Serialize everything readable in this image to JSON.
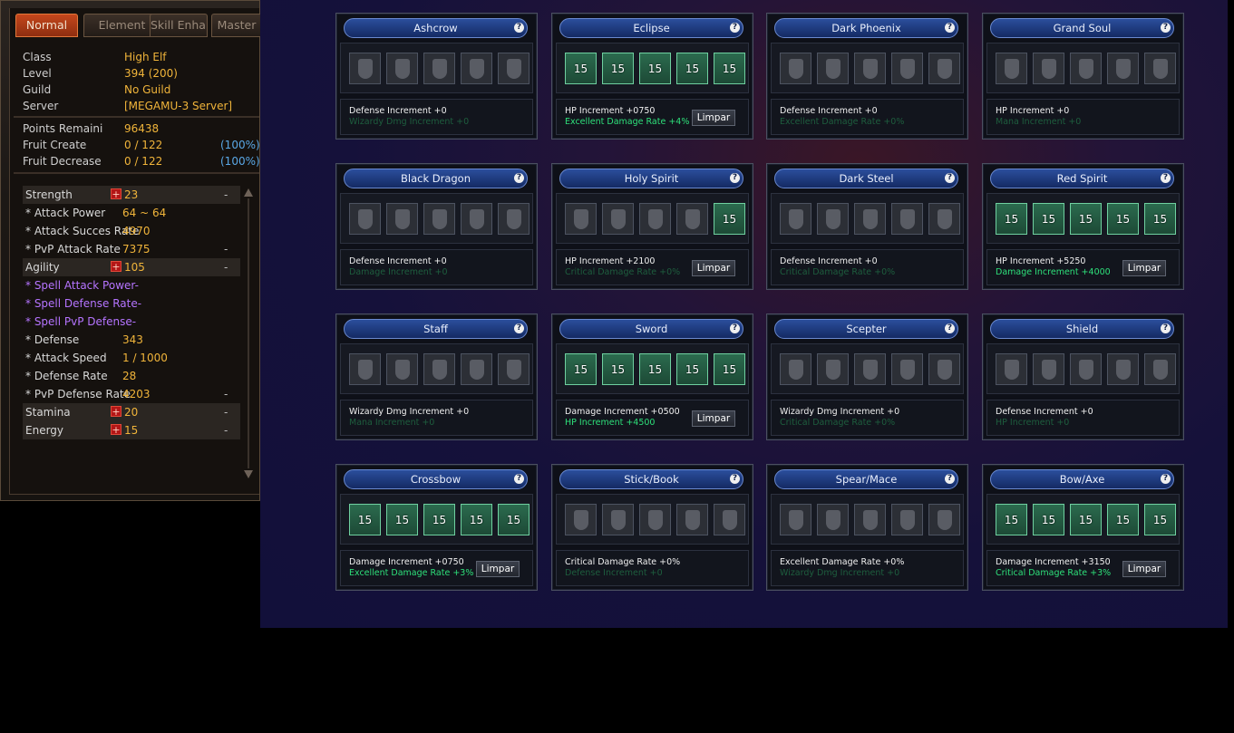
{
  "tabs": [
    "Normal",
    "Element",
    "Skill Enhar",
    "Master"
  ],
  "character": {
    "info": [
      {
        "label": "Class",
        "value": "High Elf"
      },
      {
        "label": "Level",
        "value": "394 (200)"
      },
      {
        "label": "Guild",
        "value": "No Guild"
      },
      {
        "label": "Server",
        "value": "[MEGAMU-3 Server]"
      }
    ],
    "points": [
      {
        "label": "Points Remaini",
        "value": "96438",
        "pct": ""
      },
      {
        "label": "Fruit Create",
        "value": "0 / 122",
        "pct": "(100%)"
      },
      {
        "label": "Fruit Decrease",
        "value": "0 / 122",
        "pct": "(100%)"
      }
    ],
    "stats": [
      {
        "label": "Strength",
        "value": "23",
        "kind": "main",
        "dash": "-"
      },
      {
        "label": "* Attack Power",
        "value": "64 ~ 64",
        "kind": "sub",
        "dash": ""
      },
      {
        "label": "* Attack Succes Rate",
        "value": "4970",
        "kind": "sub-tight",
        "dash": ""
      },
      {
        "label": "* PvP Attack Rate",
        "value": "7375",
        "kind": "sub",
        "dash": "-"
      },
      {
        "label": "Agility",
        "value": "105",
        "kind": "main",
        "dash": "-"
      },
      {
        "label": "* Spell Attack Power",
        "value": "-",
        "kind": "spell",
        "dash": ""
      },
      {
        "label": "* Spell Defense Rate",
        "value": "-",
        "kind": "spell",
        "dash": ""
      },
      {
        "label": "* Spell PvP Defense",
        "value": "-",
        "kind": "spell",
        "dash": ""
      },
      {
        "label": "* Defense",
        "value": "343",
        "kind": "sub",
        "dash": ""
      },
      {
        "label": "* Attack Speed",
        "value": "1 / 1000",
        "kind": "sub",
        "dash": ""
      },
      {
        "label": "* Defense Rate",
        "value": "28",
        "kind": "sub",
        "dash": ""
      },
      {
        "label": "* PvP Defense Rate",
        "value": "4203",
        "kind": "sub-tight",
        "dash": "-"
      },
      {
        "label": "Stamina",
        "value": "20",
        "kind": "main",
        "dash": "-"
      },
      {
        "label": "Energy",
        "value": "15",
        "kind": "main",
        "dash": "-"
      }
    ]
  },
  "sets": [
    {
      "name": "Ashcrow",
      "level": [
        "",
        "",
        "",
        "",
        ""
      ],
      "bonus1": "Defense Increment +0",
      "bonus2": "Wizardy Dmg Increment +0",
      "active": false,
      "clear": ""
    },
    {
      "name": "Eclipse",
      "level": [
        "15",
        "15",
        "15",
        "15",
        "15"
      ],
      "bonus1": "HP Increment +0750",
      "bonus2": "Excellent Damage Rate +4%",
      "active": true,
      "clear": "Limpar"
    },
    {
      "name": "Dark Phoenix",
      "level": [
        "",
        "",
        "",
        "",
        ""
      ],
      "bonus1": "Defense Increment +0",
      "bonus2": "Excellent Damage Rate +0%",
      "active": false,
      "clear": ""
    },
    {
      "name": "Grand Soul",
      "level": [
        "",
        "",
        "",
        "",
        ""
      ],
      "bonus1": "HP Increment +0",
      "bonus2": "Mana Increment +0",
      "active": false,
      "clear": ""
    },
    {
      "name": "Black Dragon",
      "level": [
        "",
        "",
        "",
        "",
        ""
      ],
      "bonus1": "Defense Increment +0",
      "bonus2": "Damage Increment +0",
      "active": false,
      "clear": ""
    },
    {
      "name": "Holy Spirit",
      "level": [
        "",
        "",
        "",
        "",
        "15"
      ],
      "bonus1": "HP Increment +2100",
      "bonus2": "Critical Damage Rate +0%",
      "active": false,
      "clear": "Limpar"
    },
    {
      "name": "Dark Steel",
      "level": [
        "",
        "",
        "",
        "",
        ""
      ],
      "bonus1": "Defense Increment +0",
      "bonus2": "Critical Damage Rate +0%",
      "active": false,
      "clear": ""
    },
    {
      "name": "Red Spirit",
      "level": [
        "15",
        "15",
        "15",
        "15",
        "15"
      ],
      "bonus1": "HP Increment +5250",
      "bonus2": "Damage Increment +4000",
      "active": true,
      "clear": "Limpar"
    },
    {
      "name": "Staff",
      "level": [
        "",
        "",
        "",
        "",
        ""
      ],
      "bonus1": "Wizardy Dmg Increment +0",
      "bonus2": "Mana Increment +0",
      "active": false,
      "clear": ""
    },
    {
      "name": "Sword",
      "level": [
        "15",
        "15",
        "15",
        "15",
        "15"
      ],
      "bonus1": "Damage Increment +0500",
      "bonus2": "HP Increment +4500",
      "active": true,
      "clear": "Limpar"
    },
    {
      "name": "Scepter",
      "level": [
        "",
        "",
        "",
        "",
        ""
      ],
      "bonus1": "Wizardy Dmg Increment +0",
      "bonus2": "Critical Damage Rate +0%",
      "active": false,
      "clear": ""
    },
    {
      "name": "Shield",
      "level": [
        "",
        "",
        "",
        "",
        ""
      ],
      "bonus1": "Defense Increment +0",
      "bonus2": "HP Increment +0",
      "active": false,
      "clear": ""
    },
    {
      "name": "Crossbow",
      "level": [
        "15",
        "15",
        "15",
        "15",
        "15"
      ],
      "bonus1": "Damage Increment +0750",
      "bonus2": "Excellent Damage Rate +3%",
      "active": true,
      "clear": "Limpar"
    },
    {
      "name": "Stick/Book",
      "level": [
        "",
        "",
        "",
        "",
        ""
      ],
      "bonus1": "Critical Damage Rate +0%",
      "bonus2": "Defense Increment +0",
      "active": false,
      "clear": ""
    },
    {
      "name": "Spear/Mace",
      "level": [
        "",
        "",
        "",
        "",
        ""
      ],
      "bonus1": "Excellent Damage Rate +0%",
      "bonus2": "Wizardy Dmg Increment +0",
      "active": false,
      "clear": ""
    },
    {
      "name": "Bow/Axe",
      "level": [
        "15",
        "15",
        "15",
        "15",
        "15"
      ],
      "bonus1": "Damage Increment +3150",
      "bonus2": "Critical Damage Rate +3%",
      "active": true,
      "clear": "Limpar"
    }
  ]
}
